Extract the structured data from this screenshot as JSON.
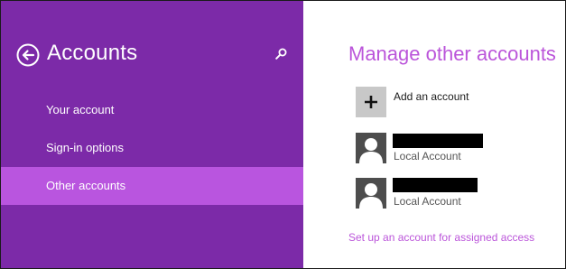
{
  "colors": {
    "sidebar_bg": "#7c2aa8",
    "selected_bg": "#b955df",
    "accent": "#bb55da",
    "tile_bg": "#c8c8c8",
    "avatar_bg": "#4d4d4d"
  },
  "sidebar": {
    "back_icon": "back-arrow-circle-icon",
    "title": "Accounts",
    "search_icon": "search-icon",
    "items": [
      {
        "label": "Your account",
        "selected": false
      },
      {
        "label": "Sign-in options",
        "selected": false
      },
      {
        "label": "Other accounts",
        "selected": true
      }
    ]
  },
  "main": {
    "title": "Manage other accounts",
    "add_account": {
      "icon": "plus-icon",
      "label": "Add an account"
    },
    "accounts": [
      {
        "name": "",
        "name_redacted": true,
        "type": "Local Account",
        "avatar_icon": "user-avatar-icon"
      },
      {
        "name": "",
        "name_redacted": true,
        "type": "Local Account",
        "avatar_icon": "user-avatar-icon"
      }
    ],
    "assigned_access_link": "Set up an account for assigned access"
  }
}
